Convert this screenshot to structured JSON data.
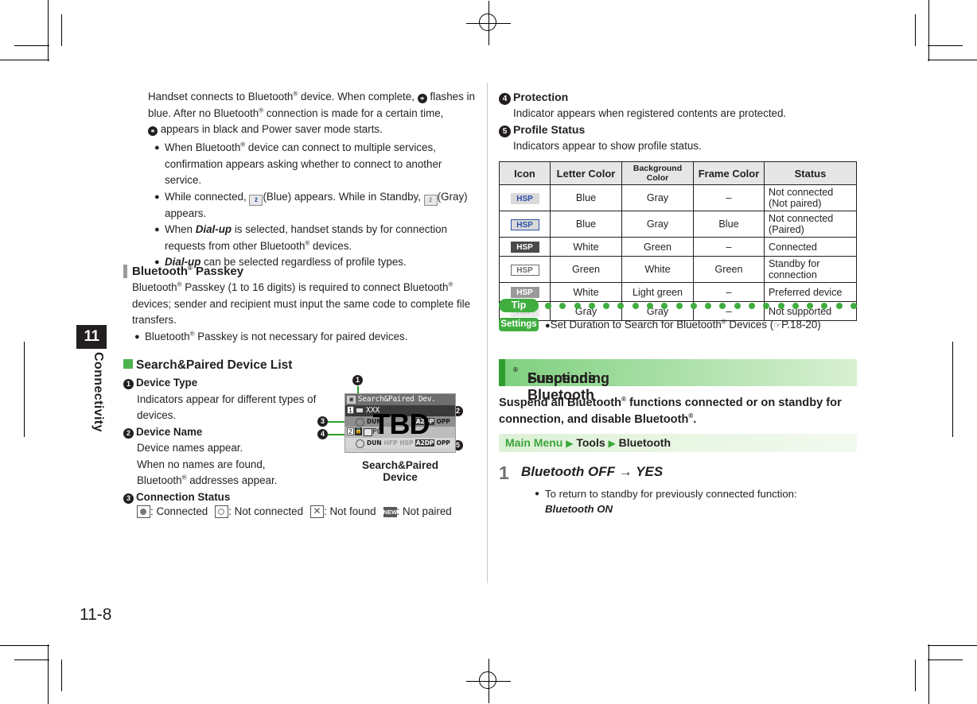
{
  "chapter": {
    "number": "11",
    "label": "Connectivity",
    "folio": "11-8"
  },
  "left_column": {
    "intro": {
      "line1_a": "Handset connects to Bluetooth",
      "line1_b": " device. When complete, ",
      "line1_c": " flashes in",
      "line2_a": "blue. After no Bluetooth",
      "line2_b": " connection is made for a certain time,",
      "line3": " appears in black and Power saver mode starts."
    },
    "bullets": [
      {
        "a": "When Bluetooth",
        "b": " device can connect to multiple services, confirmation appears asking whether to connect to another service."
      },
      {
        "a": "While connected, ",
        "icon1": "zz-blue",
        "b": "(Blue) appears. While in Standby, ",
        "icon2": "zz-gray",
        "c": "(Gray) appears."
      },
      {
        "a": "When ",
        "em": "Dial-up",
        "b": " is selected, handset stands by for connection requests from other Bluetooth",
        "c": " devices."
      },
      {
        "em": "Dial-up",
        "b": " can be selected regardless of profile types."
      }
    ],
    "passkey": {
      "heading_a": "Bluetooth",
      "heading_b": " Passkey",
      "body_a": "Bluetooth",
      "body_b": " Passkey (1 to 16 digits) is required to connect Bluetooth",
      "body_c": " devices; sender and recipient must input the same code to complete file transfers.",
      "bullet_a": "Bluetooth",
      "bullet_b": " Passkey is not necessary for paired devices."
    },
    "device_list": {
      "heading": "Search&Paired Device List",
      "items": [
        {
          "num": "1",
          "title": "Device Type",
          "body": "Indicators appear for different types of devices."
        },
        {
          "num": "2",
          "title": "Device Name",
          "body_1": "Device names appear.",
          "body_2": "When no names are found,",
          "body_3_a": "Bluetooth",
          "body_3_b": " addresses appear."
        },
        {
          "num": "3",
          "title": "Connection Status"
        }
      ],
      "status_legend": [
        {
          "icon": "filled-circle-icon",
          "label": ": Connected"
        },
        {
          "icon": "open-circle-icon",
          "label": ": Not connected"
        },
        {
          "icon": "cross-icon",
          "label": ": Not found"
        },
        {
          "icon": "new-badge-icon",
          "label": ": Not paired"
        }
      ]
    },
    "screenshot": {
      "caption": "Search&Paired Device",
      "title_bar": "Search&Paired Dev.",
      "placeholder": "TBD",
      "rows": [
        {
          "index": "1",
          "name": "XXX"
        },
        {
          "profiles": [
            {
              "t": "DUN",
              "s": "on"
            },
            {
              "t": "HFP",
              "s": "off"
            },
            {
              "t": "HSP",
              "s": "off"
            },
            {
              "t": "A2DP",
              "s": "hl"
            },
            {
              "t": "OPP",
              "s": "on"
            }
          ]
        },
        {
          "index": "2",
          "name": "PC"
        },
        {
          "profiles": [
            {
              "t": "DUN",
              "s": "on"
            },
            {
              "t": "HFP",
              "s": "off"
            },
            {
              "t": "HSP",
              "s": "off"
            },
            {
              "t": "A2DP",
              "s": "hl"
            },
            {
              "t": "OPP",
              "s": "on"
            }
          ]
        }
      ],
      "callouts": [
        "1",
        "2",
        "3",
        "4",
        "5"
      ]
    }
  },
  "right_column": {
    "items": [
      {
        "num": "4",
        "title": "Protection",
        "body": "Indicator appears when registered contents are protected."
      },
      {
        "num": "5",
        "title": "Profile Status",
        "body": "Indicators appear to show profile status."
      }
    ],
    "table": {
      "headers": [
        "Icon",
        "Letter Color",
        "Background Color",
        "Frame Color",
        "Status"
      ],
      "rows": [
        {
          "icon_label": "HSP",
          "letter": "Blue",
          "background": "Gray",
          "frame": "–",
          "status": "Not connected (Not paired)",
          "style": {
            "color": "#2a4fa8",
            "bg": "#d9d9d9",
            "border": "none"
          }
        },
        {
          "icon_label": "HSP",
          "letter": "Blue",
          "background": "Gray",
          "frame": "Blue",
          "status": "Not connected (Paired)",
          "style": {
            "color": "#2a4fa8",
            "bg": "#d9d9d9",
            "border": "#2a4fa8"
          }
        },
        {
          "icon_label": "HSP",
          "letter": "White",
          "background": "Green",
          "frame": "–",
          "status": "Connected",
          "style": {
            "color": "#ffffff",
            "bg": "#4a4a4a",
            "border": "none"
          }
        },
        {
          "icon_label": "HSP",
          "letter": "Green",
          "background": "White",
          "frame": "Green",
          "status": "Standby for connection",
          "style": {
            "color": "#6b6b6b",
            "bg": "#ffffff",
            "border": "#6b6b6b"
          }
        },
        {
          "icon_label": "HSP",
          "letter": "White",
          "background": "Light green",
          "frame": "–",
          "status": "Preferred device",
          "style": {
            "color": "#ffffff",
            "bg": "#9a9a9a",
            "border": "none"
          }
        },
        {
          "icon_label": "HSP",
          "letter": "Gray",
          "background": "Gray",
          "frame": "–",
          "status": "Not supported",
          "style": {
            "color": "#bdbdbd",
            "bg": "#e8e8e8",
            "border": "none"
          }
        }
      ]
    },
    "tip": {
      "tip_label": "Tip",
      "settings_label": "Settings",
      "text_a": "Set Duration to Search for Bluetooth",
      "text_b": " Devices (",
      "ref": "P.18-20",
      "text_c": ")"
    },
    "section": {
      "banner_a": "Suspending Bluetooth",
      "banner_b": " Functions",
      "lede_a": "Suspend all Bluetooth",
      "lede_b": " functions connected or on standby for connection, and disable Bluetooth",
      "lede_c": ".",
      "menu_main": "Main Menu",
      "menu_items": [
        "Tools",
        "Bluetooth"
      ],
      "step_number": "1",
      "step_title": "Bluetooth OFF → YES",
      "step_bullet_a": "To return to standby for previously connected function:",
      "step_bullet_b": "Bluetooth ON"
    }
  },
  "colors": {
    "green": "#4fb34f",
    "green_dark": "#2f9e2f",
    "ink": "#231f20",
    "rule": "#c9c9c9"
  }
}
